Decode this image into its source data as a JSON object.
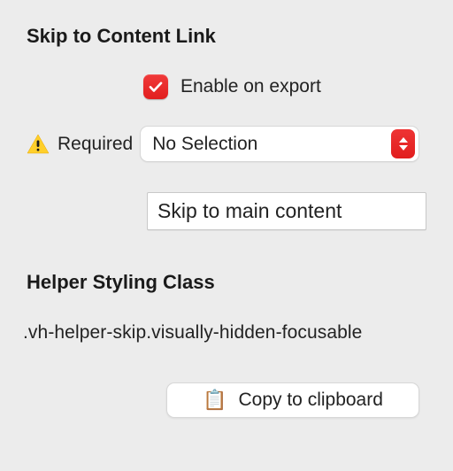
{
  "section1": {
    "title": "Skip to Content Link",
    "enable": {
      "checked": true,
      "label": "Enable on export"
    },
    "required": {
      "label": "Required",
      "select_value": "No Selection"
    },
    "skip_input": {
      "value": "Skip to main content"
    }
  },
  "section2": {
    "title": "Helper Styling Class",
    "class_text": ".vh-helper-skip.visually-hidden-focusable",
    "copy_label": "Copy to clipboard"
  }
}
